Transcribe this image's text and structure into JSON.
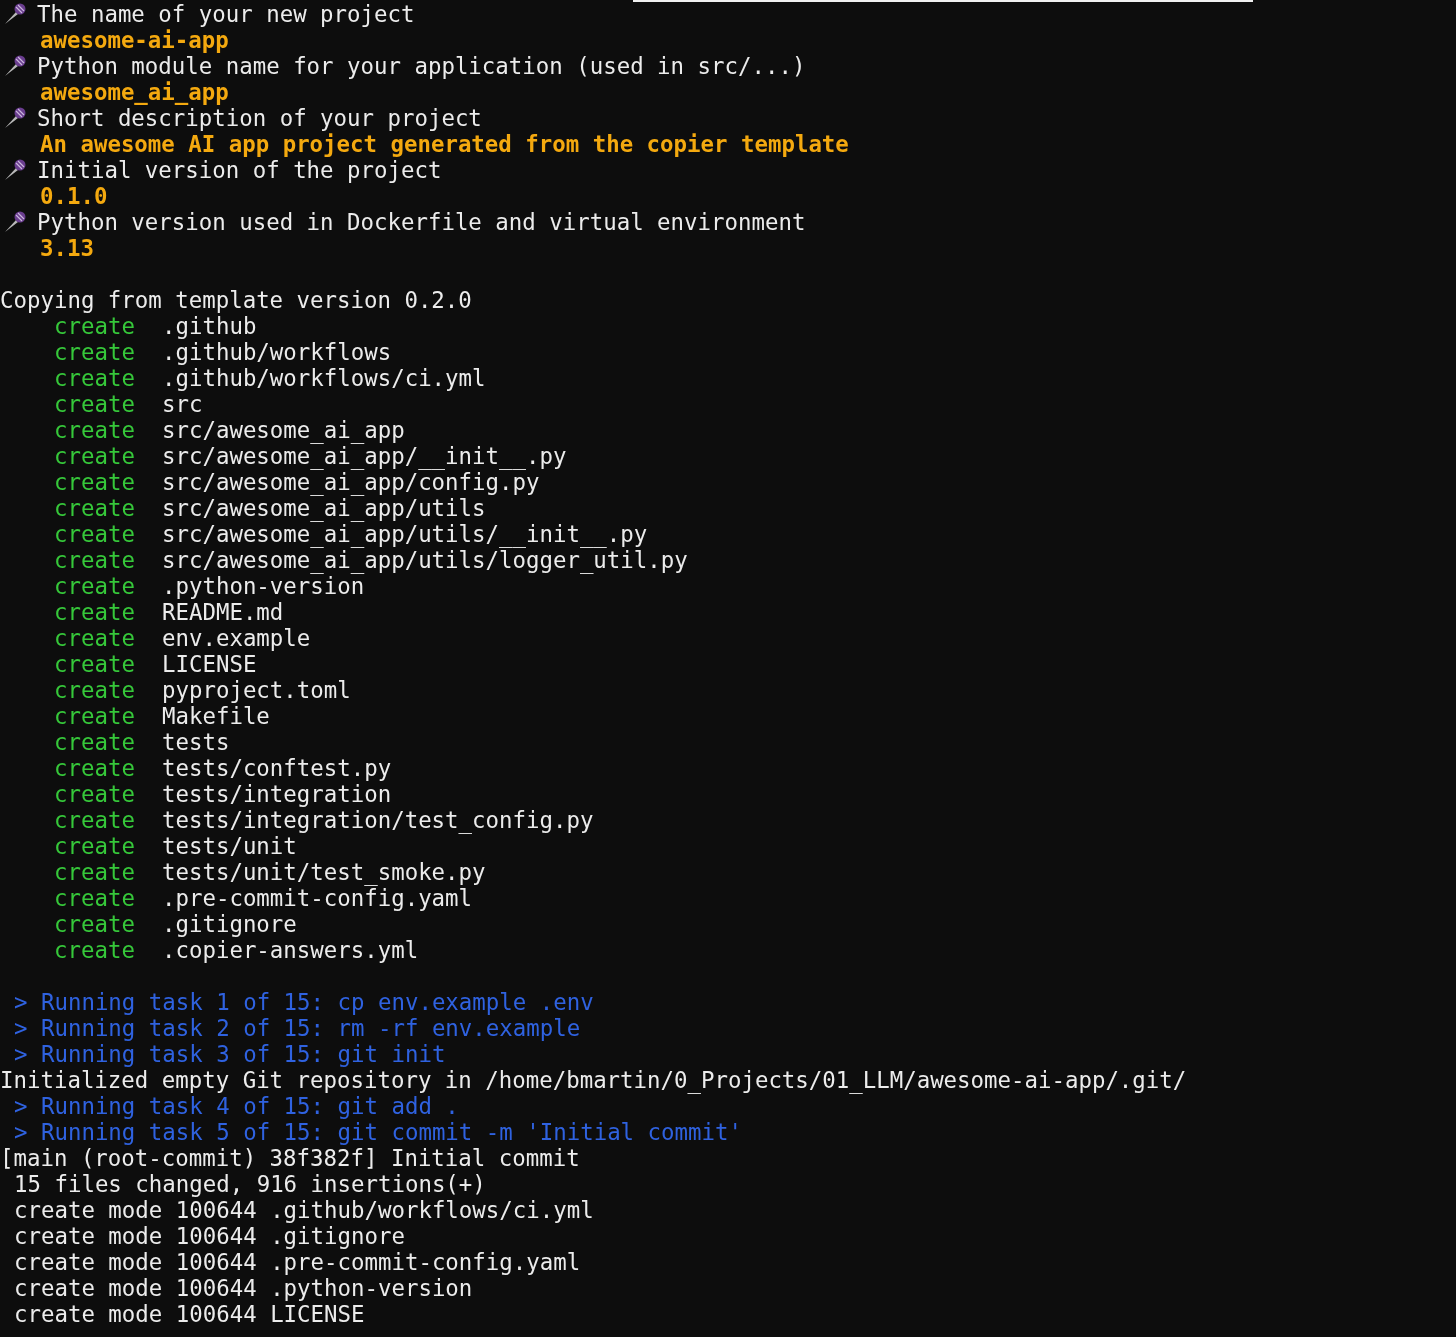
{
  "prompts": [
    {
      "question": "The name of your new project",
      "answer": "awesome-ai-app"
    },
    {
      "question": "Python module name for your application (used in src/...)",
      "answer": "awesome_ai_app"
    },
    {
      "question": "Short description of your project",
      "answer": "An awesome AI app project generated from the copier template"
    },
    {
      "question": "Initial version of the project",
      "answer": "0.1.0"
    },
    {
      "question": "Python version used in Dockerfile and virtual environment",
      "answer": "3.13"
    }
  ],
  "copying": "Copying from template version 0.2.0",
  "created": [
    {
      "action": "create",
      "path": ".github"
    },
    {
      "action": "create",
      "path": ".github/workflows"
    },
    {
      "action": "create",
      "path": ".github/workflows/ci.yml"
    },
    {
      "action": "create",
      "path": "src"
    },
    {
      "action": "create",
      "path": "src/awesome_ai_app"
    },
    {
      "action": "create",
      "path": "src/awesome_ai_app/__init__.py"
    },
    {
      "action": "create",
      "path": "src/awesome_ai_app/config.py"
    },
    {
      "action": "create",
      "path": "src/awesome_ai_app/utils"
    },
    {
      "action": "create",
      "path": "src/awesome_ai_app/utils/__init__.py"
    },
    {
      "action": "create",
      "path": "src/awesome_ai_app/utils/logger_util.py"
    },
    {
      "action": "create",
      "path": ".python-version"
    },
    {
      "action": "create",
      "path": "README.md"
    },
    {
      "action": "create",
      "path": "env.example"
    },
    {
      "action": "create",
      "path": "LICENSE"
    },
    {
      "action": "create",
      "path": "pyproject.toml"
    },
    {
      "action": "create",
      "path": "Makefile"
    },
    {
      "action": "create",
      "path": "tests"
    },
    {
      "action": "create",
      "path": "tests/conftest.py"
    },
    {
      "action": "create",
      "path": "tests/integration"
    },
    {
      "action": "create",
      "path": "tests/integration/test_config.py"
    },
    {
      "action": "create",
      "path": "tests/unit"
    },
    {
      "action": "create",
      "path": "tests/unit/test_smoke.py"
    },
    {
      "action": "create",
      "path": ".pre-commit-config.yaml"
    },
    {
      "action": "create",
      "path": ".gitignore"
    },
    {
      "action": "create",
      "path": ".copier-answers.yml"
    }
  ],
  "log": [
    {
      "kind": "task",
      "text": "> Running task 1 of 15: cp env.example .env"
    },
    {
      "kind": "task",
      "text": "> Running task 2 of 15: rm -rf env.example"
    },
    {
      "kind": "task",
      "text": "> Running task 3 of 15: git init"
    },
    {
      "kind": "output",
      "text": "Initialized empty Git repository in /home/bmartin/0_Projects/01_LLM/awesome-ai-app/.git/"
    },
    {
      "kind": "task",
      "text": "> Running task 4 of 15: git add ."
    },
    {
      "kind": "task",
      "text": "> Running task 5 of 15: git commit -m 'Initial commit'"
    },
    {
      "kind": "output",
      "text": "[main (root-commit) 38f382f] Initial commit"
    },
    {
      "kind": "indented",
      "text": "15 files changed, 916 insertions(+)"
    },
    {
      "kind": "indented",
      "text": "create mode 100644 .github/workflows/ci.yml"
    },
    {
      "kind": "indented",
      "text": "create mode 100644 .gitignore"
    },
    {
      "kind": "indented",
      "text": "create mode 100644 .pre-commit-config.yaml"
    },
    {
      "kind": "indented",
      "text": "create mode 100644 .python-version"
    },
    {
      "kind": "indented",
      "text": "create mode 100644 LICENSE"
    }
  ]
}
